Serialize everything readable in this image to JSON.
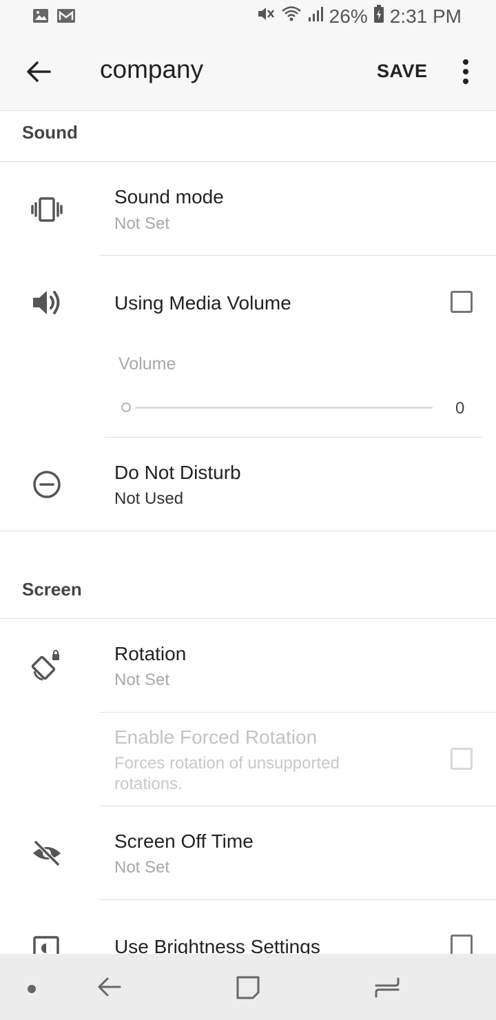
{
  "status_bar": {
    "battery": "26%",
    "time": "2:31 PM"
  },
  "app_bar": {
    "title": "company",
    "save_label": "SAVE"
  },
  "sections": {
    "sound": {
      "header": "Sound",
      "sound_mode": {
        "title": "Sound mode",
        "value": "Not Set"
      },
      "media_volume": {
        "title": "Using Media Volume",
        "checked": false
      },
      "volume": {
        "label": "Volume",
        "value": "0"
      },
      "dnd": {
        "title": "Do Not Disturb",
        "value": "Not Used"
      }
    },
    "screen": {
      "header": "Screen",
      "rotation": {
        "title": "Rotation",
        "value": "Not Set"
      },
      "forced_rotation": {
        "title": "Enable Forced Rotation",
        "desc_line1": "Forces rotation of unsupported",
        "desc_line2": "rotations.",
        "checked": false,
        "enabled": false
      },
      "screen_off": {
        "title": "Screen Off Time",
        "value": "Not Set"
      },
      "brightness": {
        "title": "Use Brightness Settings",
        "checked": false
      }
    }
  },
  "icons": {
    "status_left": [
      "image-icon",
      "mail-icon"
    ],
    "status_right": [
      "mute-icon",
      "wifi-icon",
      "signal-icon",
      "battery-icon"
    ],
    "rows": [
      "vibrate-icon",
      "volume-icon",
      "do-not-disturb-icon",
      "rotation-lock-icon",
      "eye-off-icon",
      "brightness-icon"
    ],
    "nav": [
      "dot-icon",
      "back-arrow-icon",
      "recent-square-icon",
      "switch-apps-icon"
    ]
  }
}
